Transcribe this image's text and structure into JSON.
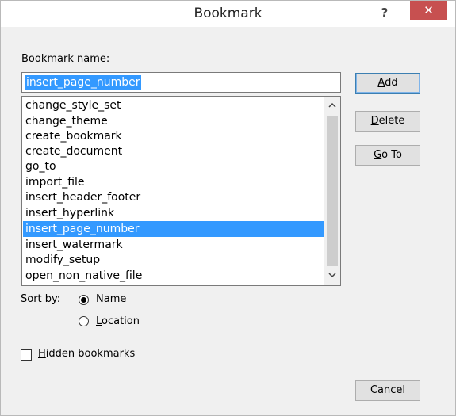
{
  "window": {
    "title": "Bookmark",
    "help_glyph": "?",
    "close_glyph": "✕"
  },
  "bookmark_name": {
    "label_accel": "B",
    "label_rest": "ookmark name:",
    "value": "insert_page_number"
  },
  "bookmarks_list": {
    "items": [
      "change_style_set",
      "change_theme",
      "create_bookmark",
      "create_document",
      "go_to",
      "import_file",
      "insert_header_footer",
      "insert_hyperlink",
      "insert_page_number",
      "insert_watermark",
      "modify_setup",
      "open_non_native_file"
    ],
    "selected_index": 8,
    "scroll_up_glyph": "^",
    "scroll_down_glyph": "v"
  },
  "buttons": {
    "add": {
      "accel": "A",
      "rest": "dd"
    },
    "delete": {
      "accel": "D",
      "rest": "elete"
    },
    "go_to": {
      "accel": "G",
      "rest": "o To"
    },
    "cancel": "Cancel"
  },
  "sort": {
    "label": "Sort by:",
    "name_option": {
      "accel": "N",
      "rest": "ame",
      "checked": true
    },
    "location_option": {
      "accel": "L",
      "rest": "ocation",
      "checked": false
    }
  },
  "hidden_bookmarks": {
    "accel": "H",
    "rest": "idden bookmarks",
    "checked": false
  },
  "colors": {
    "selection": "#3399ff",
    "close_button": "#c75050",
    "dialog_bg": "#f0f0f0"
  }
}
